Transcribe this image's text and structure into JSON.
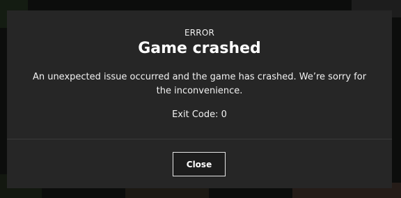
{
  "dialog": {
    "eyebrow": "ERROR",
    "title": "Game crashed",
    "message": "An unexpected issue occurred and the game has crashed. We’re sorry for the inconvenience.",
    "exit_code_label": "Exit Code: 0",
    "close_label": "Close"
  },
  "colors": {
    "dialog_background": "#262626",
    "text": "#ffffff",
    "button_border": "#e6e6e6",
    "backdrop": "#0c0d0c"
  }
}
